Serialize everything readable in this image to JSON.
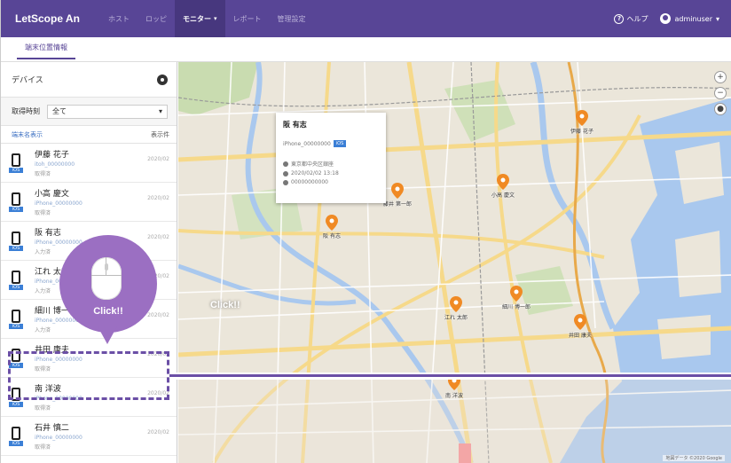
{
  "app": {
    "brand": "LetScope An",
    "nav": [
      {
        "label": "ホスト",
        "active": false
      },
      {
        "label": "ロッピ",
        "active": false
      },
      {
        "label": "モニター",
        "active": true
      },
      {
        "label": "レポート",
        "active": false
      },
      {
        "label": "管理設定",
        "active": false
      }
    ],
    "help_label": "ヘルプ",
    "user_label": "adminuser",
    "accent": "#584596"
  },
  "subtab": {
    "label": "端末位置情報"
  },
  "sidebar": {
    "device_label": "デバイス",
    "filter_label": "取得時刻",
    "filter_value": "全て",
    "list_head_left": "端末名表示",
    "list_head_right": "表示件",
    "devices": [
      {
        "name": "伊藤 花子",
        "sub": "itoh_00000000",
        "status": "取得済",
        "right": "2020/02",
        "badge": "iOS"
      },
      {
        "name": "小高 慶文",
        "sub": "iPhone_00000000",
        "status": "取得済",
        "right": "2020/02",
        "badge": "iOS"
      },
      {
        "name": "阪 有志",
        "sub": "iPhone_00000000",
        "status": "入力済",
        "right": "2020/02",
        "badge": "iOS"
      },
      {
        "name": "江れ 太郎",
        "sub": "iPhone_00000000",
        "status": "入力済",
        "right": "2020/02",
        "badge": "iOS"
      },
      {
        "name": "細川 博一郎",
        "sub": "iPhone_00000000",
        "status": "入力済",
        "right": "2020/02",
        "badge": "iOS"
      },
      {
        "name": "井田 康夫",
        "sub": "iPhone_00000000",
        "status": "取得済",
        "right": "2020/02",
        "badge": "iOS"
      },
      {
        "name": "南 洋波",
        "sub": "iPhone_00000000",
        "status": "取得済",
        "right": "2020/02",
        "badge": "iOS"
      },
      {
        "name": "石井 慎二",
        "sub": "iPhone_00000000",
        "status": "取得済",
        "right": "2020/02",
        "badge": "iOS"
      }
    ]
  },
  "popup": {
    "name": "阪 有志",
    "device": "iPhone_00000000",
    "badge": "iOS",
    "address": "東京都中央区銀座",
    "datetime": "2020/02/02 13:18",
    "phone": "00000000000"
  },
  "map": {
    "click_label": "Click!!",
    "footer": "地図データ ©2020 Google",
    "zoom_in": "+",
    "zoom_out": "−",
    "pins": [
      {
        "label": "阪 有志"
      },
      {
        "label": "藤井 第一郎"
      },
      {
        "label": "小高 慶文"
      },
      {
        "label": "伊藤 花子"
      },
      {
        "label": "江れ 太郎"
      },
      {
        "label": "細川 博一郎"
      },
      {
        "label": "井田 康夫"
      },
      {
        "label": "南 洋波"
      }
    ]
  },
  "overlay": {
    "bubble_text": "Click!!",
    "bubble_color": "#9b6fc2",
    "line_color": "#6b4fa6"
  }
}
